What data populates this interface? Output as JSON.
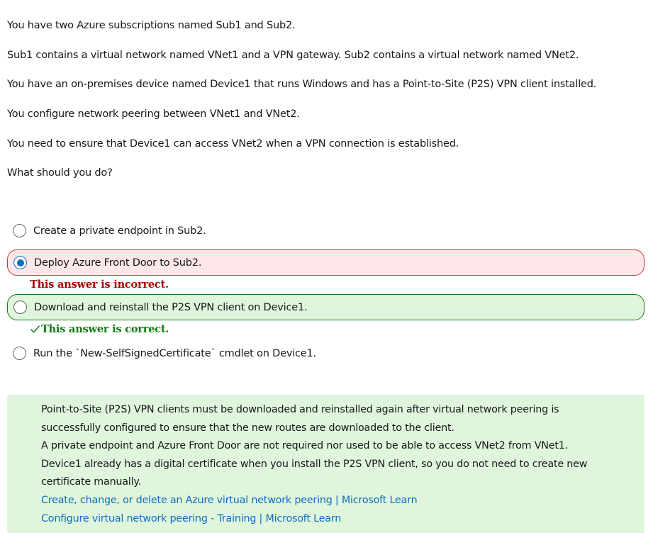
{
  "question": {
    "lines": [
      "You have two Azure subscriptions named Sub1 and Sub2.",
      "Sub1 contains a virtual network named VNet1 and a VPN gateway. Sub2 contains a virtual network named VNet2.",
      "You have an on-premises device named Device1 that runs Windows and has a Point-to-Site (P2S) VPN client installed.",
      "You configure network peering between VNet1 and VNet2.",
      "You need to ensure that Device1 can access VNet2 when a VPN connection is established.",
      "What should you do?"
    ]
  },
  "options": [
    {
      "label": "Create a private endpoint in Sub2.",
      "selected": false,
      "state": "none"
    },
    {
      "label": "Deploy Azure Front Door to Sub2.",
      "selected": true,
      "state": "incorrect"
    },
    {
      "label": "Download and reinstall the P2S VPN client on Device1.",
      "selected": false,
      "state": "correct"
    },
    {
      "label": "Run the `New-SelfSignedCertificate` cmdlet on Device1.",
      "selected": false,
      "state": "none"
    }
  ],
  "feedback": {
    "incorrect": "This answer is incorrect.",
    "correct": "This answer is correct."
  },
  "explanation": {
    "lines": [
      "Point-to-Site (P2S) VPN clients must be downloaded and reinstalled again after virtual network peering is",
      "successfully configured to ensure that the new routes are downloaded to the client.",
      "A private endpoint and Azure Front Door are not required nor used to be able to access VNet2 from VNet1.",
      "Device1 already has a digital certificate when you install the P2S VPN client, so you do not need to create new",
      "certificate manually."
    ],
    "links": [
      "Create, change, or delete an Azure virtual network peering | Microsoft Learn",
      "Configure virtual network peering - Training | Microsoft Learn"
    ]
  },
  "colors": {
    "incorrect_bg": "#fde7e9",
    "incorrect_border": "#d1343b",
    "incorrect_text": "#a80000",
    "correct_bg": "#dff6dd",
    "correct_border": "#107c10",
    "link": "#0f6cbd",
    "radio_selected": "#0f6cbd"
  },
  "icons": {
    "feedback_correct": "check-icon"
  }
}
